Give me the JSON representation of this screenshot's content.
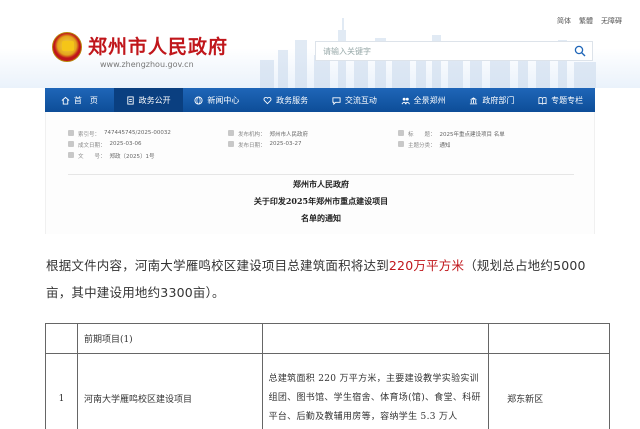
{
  "header": {
    "top_links": [
      "简体",
      "繁體",
      "无障碍"
    ],
    "site_title": "郑州市人民政府",
    "site_url": "www.zhengzhou.gov.cn",
    "search_placeholder": "请输入关键字"
  },
  "nav": {
    "items": [
      {
        "label": "首　页",
        "icon": "home-icon"
      },
      {
        "label": "政务公开",
        "icon": "document-icon"
      },
      {
        "label": "新闻中心",
        "icon": "globe-icon"
      },
      {
        "label": "政务服务",
        "icon": "heart-icon"
      },
      {
        "label": "交流互动",
        "icon": "chat-icon"
      },
      {
        "label": "全景郑州",
        "icon": "people-icon"
      },
      {
        "label": "政府部门",
        "icon": "building-icon"
      },
      {
        "label": "专题专栏",
        "icon": "book-icon"
      }
    ],
    "active_index": 1
  },
  "doc": {
    "meta": {
      "index_no_label": "索引号：",
      "index_no": "747445745/2025-00032",
      "publisher_label": "发布机构：",
      "publisher": "郑州市人民政府",
      "title_label": "标　　题：",
      "title": "2025年重点建设项目 名单",
      "created_label": "成文日期：",
      "created": "2025-03-06",
      "published_label": "发布日期：",
      "published": "2025-03-27",
      "category_label": "主题分类：",
      "category": "通知",
      "doc_no_label": "文　　号：",
      "doc_no": "郑政〔2025〕1号"
    },
    "title_lines": [
      "郑州市人民政府",
      "关于印发2025年郑州市重点建设项目",
      "名单的通知"
    ]
  },
  "body": {
    "text_before": "根据文件内容，河南大学雁鸣校区建设项目总建筑面积将达到",
    "highlight": "220万平方米",
    "text_after": "（规划总占地约5000亩，其中建设用地约3300亩）。"
  },
  "table": {
    "section_header": "前期项目(1)",
    "row": {
      "index": "1",
      "name": "河南大学雁鸣校区建设项目",
      "content": "总建筑面积 220 万平方米，主要建设教学实验实训组团、图书馆、学生宿舍、体育场(馆)、食堂、科研平台、后勤及教辅用房等，容纳学生 5.3 万人",
      "district": "郑东新区"
    }
  },
  "colors": {
    "brand_red": "#c0161b",
    "nav_blue": "#1f66b8",
    "highlight_red": "#c0161b"
  }
}
